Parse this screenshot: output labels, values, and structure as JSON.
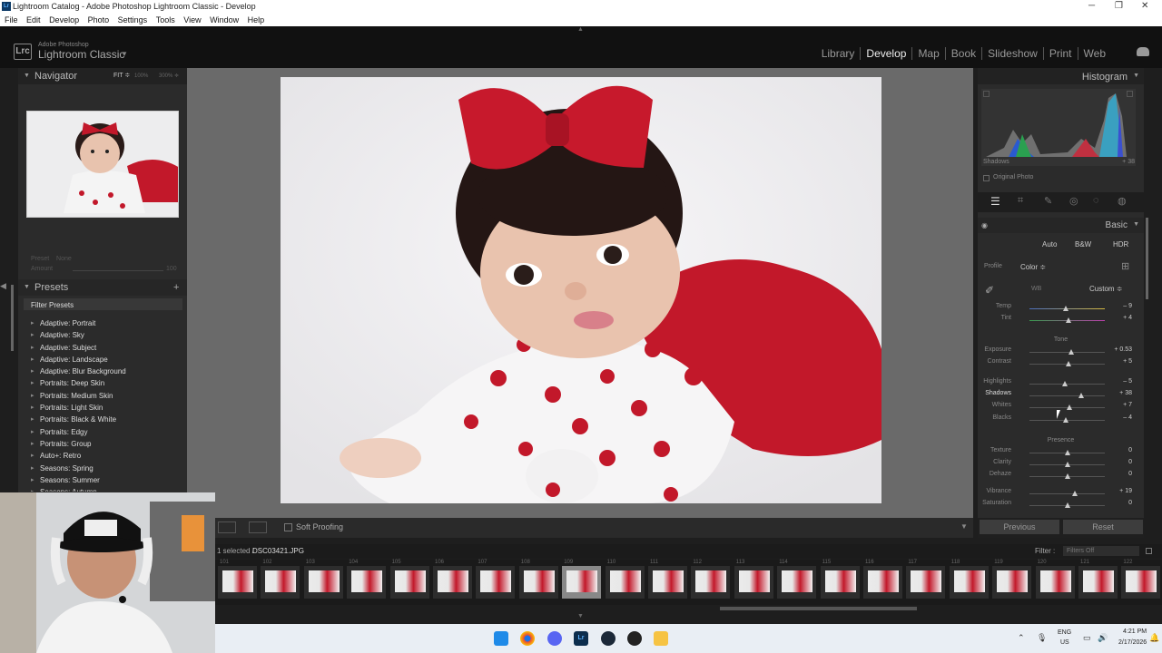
{
  "window": {
    "title": "Lightroom Catalog - Adobe Photoshop Lightroom Classic - Develop"
  },
  "menu": [
    "File",
    "Edit",
    "Develop",
    "Photo",
    "Settings",
    "Tools",
    "View",
    "Window",
    "Help"
  ],
  "brand": {
    "line1": "Adobe Photoshop",
    "line2": "Lightroom Classic",
    "logo": "Lrc"
  },
  "modules": [
    "Library",
    "Develop",
    "Map",
    "Book",
    "Slideshow",
    "Print",
    "Web"
  ],
  "active_module": "Develop",
  "navigator": {
    "title": "Navigator",
    "fit": "FIT ≑",
    "z1": "100%",
    "z2": "300% ≑"
  },
  "preset_amount": {
    "preset_label": "Preset",
    "preset_value": "None",
    "amount_label": "Amount",
    "amount_value": "100"
  },
  "presets": {
    "title": "Presets",
    "filter": "Filter Presets",
    "items": [
      "Adaptive: Portrait",
      "Adaptive: Sky",
      "Adaptive: Subject",
      "Adaptive: Landscape",
      "Adaptive: Blur Background",
      "Portraits: Deep Skin",
      "Portraits: Medium Skin",
      "Portraits: Light Skin",
      "Portraits: Black & White",
      "Portraits: Edgy",
      "Portraits: Group",
      "Auto+: Retro",
      "Seasons: Spring",
      "Seasons: Summer",
      "Seasons: Autumn"
    ]
  },
  "toolbar": {
    "soft_proofing": "Soft Proofing"
  },
  "histogram": {
    "title": "Histogram",
    "shadows_label": "Shadows",
    "shadows_value": "+ 38",
    "original_photo": "Original Photo"
  },
  "basic": {
    "title": "Basic",
    "auto": "Auto",
    "bw": "B&W",
    "hdr": "HDR",
    "profile_label": "Profile",
    "profile_value": "Color ≑",
    "wb_label": "WB",
    "wb_value": "Custom ≑",
    "tone_label": "Tone",
    "presence_label": "Presence",
    "sliders": [
      {
        "label": "Temp",
        "value": "– 9",
        "pos": 0.48
      },
      {
        "label": "Tint",
        "value": "+ 4",
        "pos": 0.52
      },
      {
        "label": "Exposure",
        "value": "+ 0.53",
        "pos": 0.55
      },
      {
        "label": "Contrast",
        "value": "+ 5",
        "pos": 0.52
      },
      {
        "label": "Highlights",
        "value": "– 5",
        "pos": 0.47
      },
      {
        "label": "Shadows",
        "value": "+ 38",
        "pos": 0.69
      },
      {
        "label": "Whites",
        "value": "+ 7",
        "pos": 0.53
      },
      {
        "label": "Blacks",
        "value": "– 4",
        "pos": 0.48
      },
      {
        "label": "Texture",
        "value": "0",
        "pos": 0.5
      },
      {
        "label": "Clarity",
        "value": "0",
        "pos": 0.5
      },
      {
        "label": "Dehaze",
        "value": "0",
        "pos": 0.5
      },
      {
        "label": "Vibrance",
        "value": "+ 19",
        "pos": 0.6
      },
      {
        "label": "Saturation",
        "value": "0",
        "pos": 0.5
      }
    ]
  },
  "buttons": {
    "previous": "Previous",
    "reset": "Reset"
  },
  "filmstrip": {
    "selected_text": "1 selected /",
    "filename": "DSC03421.JPG",
    "filter_label": "Filter :",
    "filter_value": "Filters Off",
    "numbers": [
      "101",
      "102",
      "103",
      "104",
      "105",
      "106",
      "107",
      "108",
      "109",
      "110",
      "111",
      "112",
      "113",
      "114",
      "115",
      "116",
      "117",
      "118",
      "119",
      "120",
      "121",
      "122"
    ],
    "selected_number": "109"
  },
  "tray": {
    "lang1": "ENG",
    "lang2": "US",
    "time": "4:21 PM",
    "date": "2/17/2026"
  },
  "colors": {
    "accent": "#c2182a",
    "panel": "#2b2b2b",
    "center": "#6a6a6a"
  }
}
